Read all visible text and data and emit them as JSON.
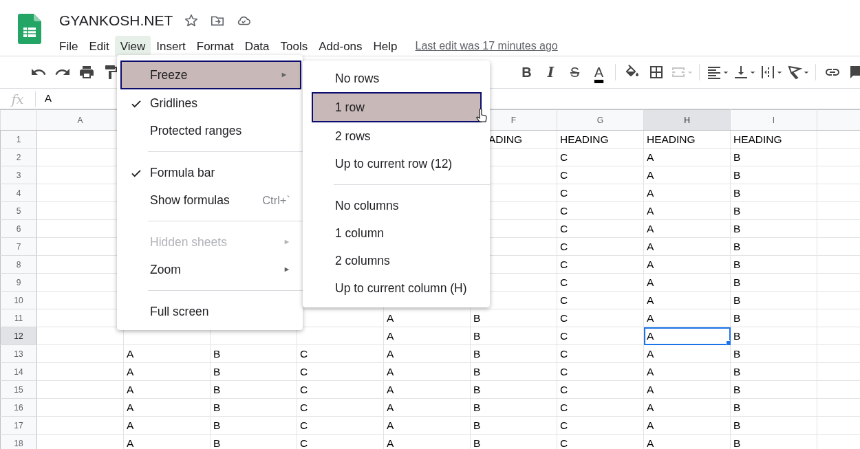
{
  "document": {
    "title": "GYANKOSH.NET"
  },
  "menu_bar": [
    {
      "label": "File",
      "selected": false
    },
    {
      "label": "Edit",
      "selected": false
    },
    {
      "label": "View",
      "selected": true
    },
    {
      "label": "Insert",
      "selected": false
    },
    {
      "label": "Format",
      "selected": false
    },
    {
      "label": "Data",
      "selected": false
    },
    {
      "label": "Tools",
      "selected": false
    },
    {
      "label": "Add-ons",
      "selected": false
    },
    {
      "label": "Help",
      "selected": false
    }
  ],
  "last_edit": "Last edit was 17 minutes ago",
  "toolbar": {
    "format_buttons": [
      {
        "kind": "bold",
        "label": "B"
      },
      {
        "kind": "italic",
        "label": "I"
      },
      {
        "kind": "strike",
        "label": "S"
      },
      {
        "kind": "color",
        "label": "A"
      }
    ],
    "merge_disabled": true
  },
  "formula_bar": {
    "fx": "fx",
    "value": "A"
  },
  "columns": [
    {
      "label": "A",
      "selected": false
    },
    null,
    null,
    null,
    null,
    {
      "label": "F",
      "selected": false
    },
    {
      "label": "G",
      "selected": false
    },
    {
      "label": "H",
      "selected": true
    },
    {
      "label": "I",
      "selected": false
    }
  ],
  "rows": [
    {
      "number": "1",
      "selected": false,
      "cells": [
        null,
        null,
        null,
        null,
        null,
        "ADING",
        "HEADING",
        "HEADING",
        "HEADING"
      ]
    },
    {
      "number": "2",
      "selected": false,
      "cells": [
        null,
        null,
        null,
        null,
        null,
        null,
        "C",
        "A",
        "B"
      ]
    },
    {
      "number": "3",
      "selected": false,
      "cells": [
        null,
        null,
        null,
        null,
        null,
        null,
        "C",
        "A",
        "B"
      ]
    },
    {
      "number": "4",
      "selected": false,
      "cells": [
        null,
        null,
        null,
        null,
        null,
        null,
        "C",
        "A",
        "B"
      ]
    },
    {
      "number": "5",
      "selected": false,
      "cells": [
        null,
        null,
        null,
        null,
        null,
        null,
        "C",
        "A",
        "B"
      ]
    },
    {
      "number": "6",
      "selected": false,
      "cells": [
        null,
        null,
        null,
        null,
        null,
        null,
        "C",
        "A",
        "B"
      ]
    },
    {
      "number": "7",
      "selected": false,
      "cells": [
        null,
        null,
        null,
        null,
        null,
        null,
        "C",
        "A",
        "B"
      ]
    },
    {
      "number": "8",
      "selected": false,
      "cells": [
        null,
        null,
        null,
        null,
        null,
        null,
        "C",
        "A",
        "B"
      ]
    },
    {
      "number": "9",
      "selected": false,
      "cells": [
        null,
        null,
        null,
        null,
        null,
        null,
        "C",
        "A",
        "B"
      ]
    },
    {
      "number": "10",
      "selected": false,
      "cells": [
        null,
        null,
        null,
        null,
        null,
        null,
        "C",
        "A",
        "B"
      ]
    },
    {
      "number": "11",
      "selected": false,
      "cells": [
        null,
        null,
        null,
        null,
        "A",
        "B",
        "C",
        "A",
        "B"
      ]
    },
    {
      "number": "12",
      "selected": true,
      "cells": [
        null,
        null,
        null,
        null,
        "A",
        "B",
        "C",
        "A",
        "B"
      ]
    },
    {
      "number": "13",
      "selected": false,
      "cells": [
        null,
        "A",
        "B",
        "C",
        "A",
        "B",
        "C",
        "A",
        "B"
      ]
    },
    {
      "number": "14",
      "selected": false,
      "cells": [
        null,
        "A",
        "B",
        "C",
        "A",
        "B",
        "C",
        "A",
        "B"
      ]
    },
    {
      "number": "15",
      "selected": false,
      "cells": [
        null,
        "A",
        "B",
        "C",
        "A",
        "B",
        "C",
        "A",
        "B"
      ]
    },
    {
      "number": "16",
      "selected": false,
      "cells": [
        null,
        "A",
        "B",
        "C",
        "A",
        "B",
        "C",
        "A",
        "B"
      ]
    },
    {
      "number": "17",
      "selected": false,
      "cells": [
        null,
        "A",
        "B",
        "C",
        "A",
        "B",
        "C",
        "A",
        "B"
      ]
    },
    {
      "number": "18",
      "selected": false,
      "cells": [
        null,
        "A",
        "B",
        "C",
        "A",
        "B",
        "C",
        "A",
        "B"
      ]
    }
  ],
  "view_menu": [
    {
      "kind": "item",
      "label": "Freeze",
      "checked": false,
      "submenu": true,
      "disabled": false,
      "selected": true
    },
    {
      "kind": "item",
      "label": "Gridlines",
      "checked": true,
      "submenu": false,
      "disabled": false,
      "selected": false
    },
    {
      "kind": "item",
      "label": "Protected ranges",
      "checked": false,
      "submenu": false,
      "disabled": false,
      "selected": false
    },
    {
      "kind": "separator"
    },
    {
      "kind": "item",
      "label": "Formula bar",
      "checked": true,
      "submenu": false,
      "disabled": false,
      "selected": false
    },
    {
      "kind": "item",
      "label": "Show formulas",
      "shortcut": "Ctrl+`",
      "checked": false,
      "submenu": false,
      "disabled": false,
      "selected": false
    },
    {
      "kind": "separator"
    },
    {
      "kind": "item",
      "label": "Hidden sheets",
      "checked": false,
      "submenu": true,
      "disabled": true,
      "selected": false
    },
    {
      "kind": "item",
      "label": "Zoom",
      "checked": false,
      "submenu": true,
      "disabled": false,
      "selected": false
    },
    {
      "kind": "separator"
    },
    {
      "kind": "item",
      "label": "Full screen",
      "checked": false,
      "submenu": false,
      "disabled": false,
      "selected": false
    }
  ],
  "freeze_menu": [
    {
      "kind": "item",
      "label": "No rows",
      "selected": false
    },
    {
      "kind": "item",
      "label": "1 row",
      "selected": true
    },
    {
      "kind": "item",
      "label": "2 rows",
      "selected": false
    },
    {
      "kind": "item",
      "label": "Up to current row (12)",
      "selected": false
    },
    {
      "kind": "separator"
    },
    {
      "kind": "item",
      "label": "No columns",
      "selected": false
    },
    {
      "kind": "item",
      "label": "1 column",
      "selected": false
    },
    {
      "kind": "item",
      "label": "2 columns",
      "selected": false
    },
    {
      "kind": "item",
      "label": "Up to current column (H)",
      "selected": false
    }
  ]
}
